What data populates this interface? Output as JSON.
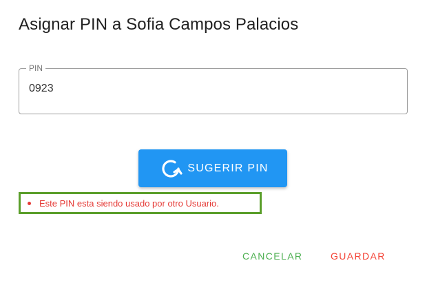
{
  "dialog": {
    "title": "Asignar PIN a Sofia Campos Palacios"
  },
  "pin_field": {
    "label": "PIN",
    "value": "0923"
  },
  "suggest_button": {
    "label": "SUGERIR PIN",
    "icon": "refresh-icon"
  },
  "error": {
    "message": "Este PIN esta siendo usado por otro Usuario."
  },
  "actions": {
    "cancel_label": "CANCELAR",
    "save_label": "GUARDAR"
  },
  "colors": {
    "primary": "#2196f3",
    "error": "#e53935",
    "cancel": "#4caf50",
    "save": "#f44336",
    "highlight_border": "#5a9e2a"
  }
}
